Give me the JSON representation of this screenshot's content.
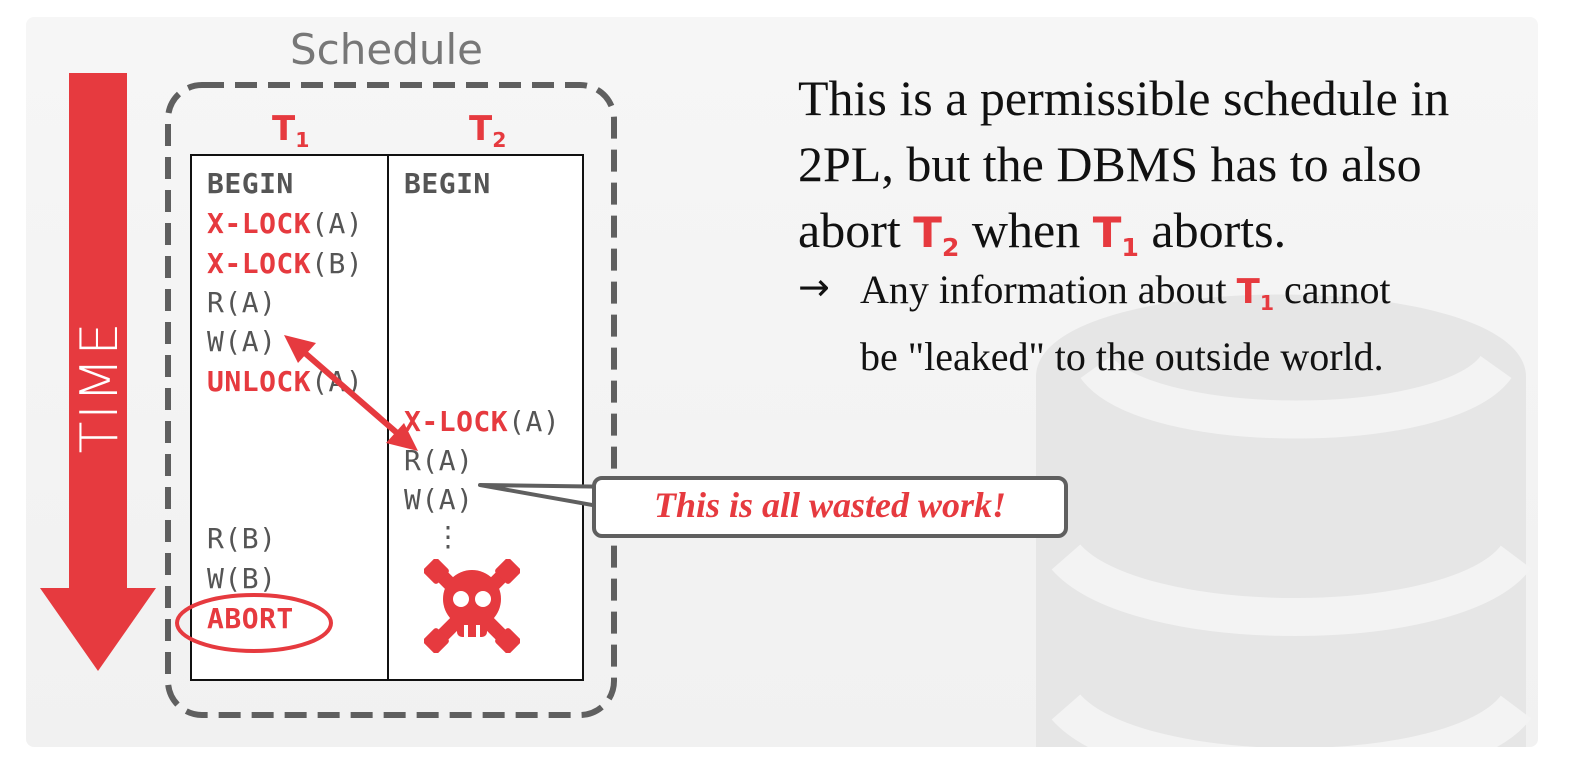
{
  "diagram": {
    "time_label": "TIME",
    "schedule_title": "Schedule",
    "t1_header": "T",
    "t1_sub": "1",
    "t2_header": "T",
    "t2_sub": "2",
    "t1_ops": [
      {
        "kw": "BEGIN",
        "arg": ""
      },
      {
        "kw": "X-LOCK",
        "arg": "(A)"
      },
      {
        "kw": "X-LOCK",
        "arg": "(B)"
      },
      {
        "kw": "",
        "arg": "R(A)"
      },
      {
        "kw": "",
        "arg": "W(A)"
      },
      {
        "kw": "UNLOCK",
        "arg": "(A)"
      },
      {
        "kw": "",
        "arg": "R(B)"
      },
      {
        "kw": "",
        "arg": "W(B)"
      },
      {
        "kw": "ABORT",
        "arg": ""
      }
    ],
    "t2_ops": [
      {
        "kw": "BEGIN",
        "arg": ""
      },
      {
        "kw": "X-LOCK",
        "arg": "(A)"
      },
      {
        "kw": "",
        "arg": "R(A)"
      },
      {
        "kw": "",
        "arg": "W(A)"
      },
      {
        "kw": "",
        "arg": "⋮"
      }
    ],
    "callout": "This is all wasted work!"
  },
  "text": {
    "line1": "This is a permissible schedule in",
    "line2": "2PL, but the DBMS has to also",
    "line3_a": "abort ",
    "line3_t": "T",
    "line3_tsub": "2",
    "line3_b": " when ",
    "line3_t2": "T",
    "line3_t2sub": "1",
    "line3_c": " aborts.",
    "bullet_arrow": "→",
    "bullet_a": "Any information about ",
    "bullet_t": "T",
    "bullet_tsub": "1",
    "bullet_b": " cannot",
    "bullet_line2": "be \"leaked\" to the outside world."
  },
  "colors": {
    "accent": "#e63a3f",
    "frame": "#5f5f5f",
    "text": "#111111"
  }
}
